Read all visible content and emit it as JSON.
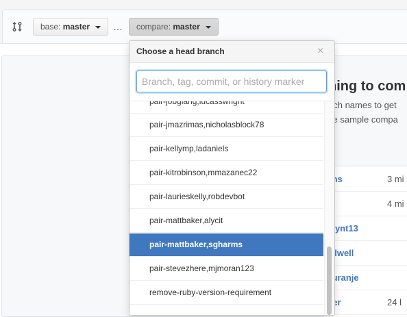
{
  "toolbar": {
    "base": {
      "key": "base:",
      "value": "master"
    },
    "ellipsis": "…",
    "compare": {
      "key": "compare:",
      "value": "master"
    }
  },
  "blankslate": {
    "heading": "hing to com",
    "line1": "nch names to get",
    "line2": "se sample compa"
  },
  "examples": [
    {
      "name": "ms",
      "time": "3 mi"
    },
    {
      "name": "",
      "time": "4 mi"
    },
    {
      "name": "uynt13",
      "time": ""
    },
    {
      "name": "alwell",
      "time": ""
    },
    {
      "name": "luranje",
      "time": ""
    },
    {
      "name": "ter",
      "time": "24 l"
    }
  ],
  "dropdown": {
    "title": "Choose a head branch",
    "close": "×",
    "filter_placeholder": "Branch, tag, commit, or history marker",
    "items": [
      {
        "label": "pair-jobgiang,lucasswright",
        "selected": false
      },
      {
        "label": "pair-jmazrimas,nicholasblock78",
        "selected": false
      },
      {
        "label": "pair-kellymp,ladaniels",
        "selected": false
      },
      {
        "label": "pair-kitrobinson,mmazanec22",
        "selected": false
      },
      {
        "label": "pair-laurieskelly,robdevbot",
        "selected": false
      },
      {
        "label": "pair-mattbaker,alycit",
        "selected": false
      },
      {
        "label": "pair-mattbaker,sgharms",
        "selected": true
      },
      {
        "label": "pair-stevezhere,mjmoran123",
        "selected": false
      },
      {
        "label": "remove-ruby-version-requirement",
        "selected": false
      }
    ]
  },
  "colors": {
    "accent": "#4078c0",
    "link": "#4078c0"
  },
  "icons": {
    "compare": "git-compare-icon",
    "caret": "caret-down-icon",
    "close": "close-icon"
  }
}
